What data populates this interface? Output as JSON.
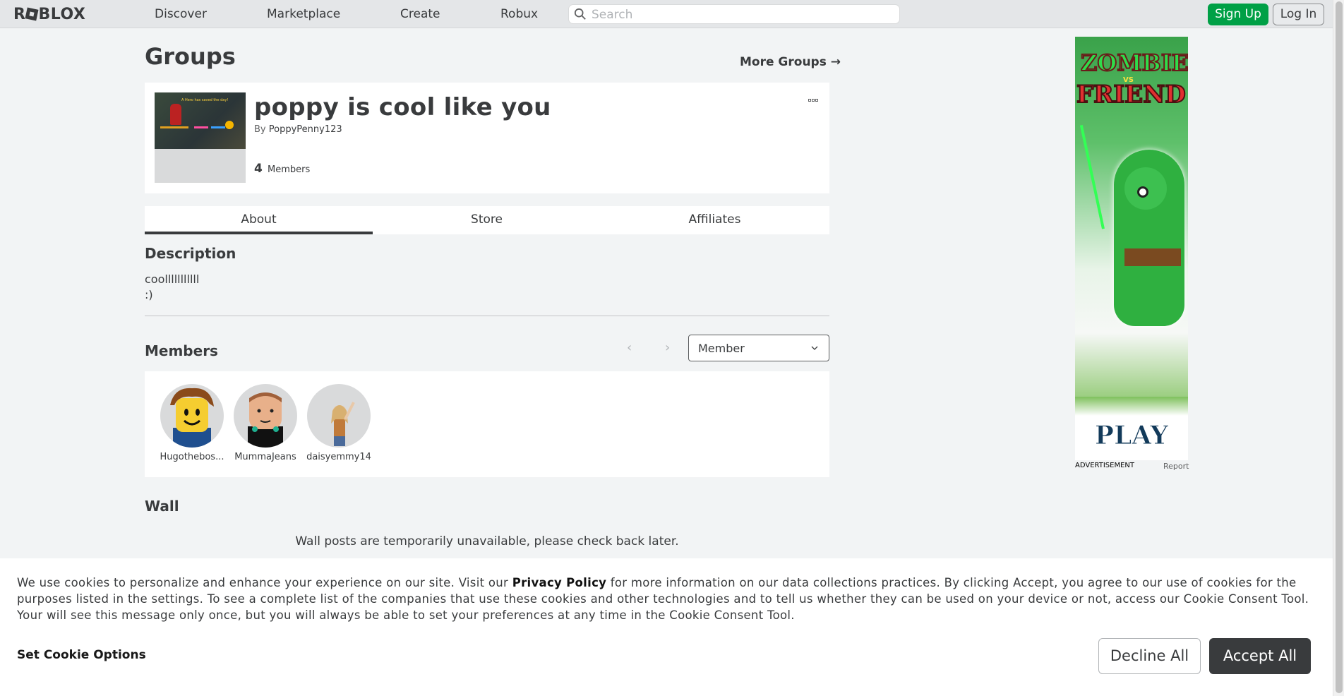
{
  "nav": {
    "logo": "ROBLOX",
    "links": [
      "Discover",
      "Marketplace",
      "Create",
      "Robux"
    ],
    "search_placeholder": "Search",
    "signup_label": "Sign Up",
    "login_label": "Log In"
  },
  "page": {
    "title": "Groups",
    "more_groups": "More Groups →"
  },
  "group": {
    "name": "poppy is cool like you",
    "by_label": "By",
    "owner": "PoppyPenny123",
    "member_count": "4",
    "members_label": "Members",
    "emblem_tag": "A Hero has saved the day!"
  },
  "tabs": [
    {
      "label": "About",
      "active": true
    },
    {
      "label": "Store",
      "active": false
    },
    {
      "label": "Affiliates",
      "active": false
    }
  ],
  "description": {
    "title": "Description",
    "text": "coolllllllllll\n:)"
  },
  "members": {
    "title": "Members",
    "role_selected": "Member",
    "list": [
      {
        "name": "Hugothebos..."
      },
      {
        "name": "MummaJeans"
      },
      {
        "name": "daisyemmy14"
      }
    ]
  },
  "wall": {
    "title": "Wall",
    "message": "Wall posts are temporarily unavailable, please check back later."
  },
  "ad": {
    "title_line1": "ZOMBIE",
    "vs": "VS",
    "title_line2": "FRIEND",
    "cta": "PLAY",
    "label": "ADVERTISEMENT",
    "report": "Report"
  },
  "cookie": {
    "text_before": "We use cookies to personalize and enhance your experience on our site. Visit our ",
    "privacy_link": "Privacy Policy",
    "text_after": " for more information on our data collections practices. By clicking Accept, you agree to our use of cookies for the purposes listed in the settings. To see a complete list of the companies that use these cookies and other technologies and to tell us whether they can be used on your device or not, access our Cookie Consent Tool. Your will see this message only once, but you will always be able to set your preferences at any time in the Cookie Consent Tool.",
    "settings_label": "Set Cookie Options",
    "decline_label": "Decline All",
    "accept_label": "Accept All"
  },
  "colors": {
    "signup": "#00a046",
    "accept": "#393b3d",
    "background": "#f2f4f5"
  }
}
